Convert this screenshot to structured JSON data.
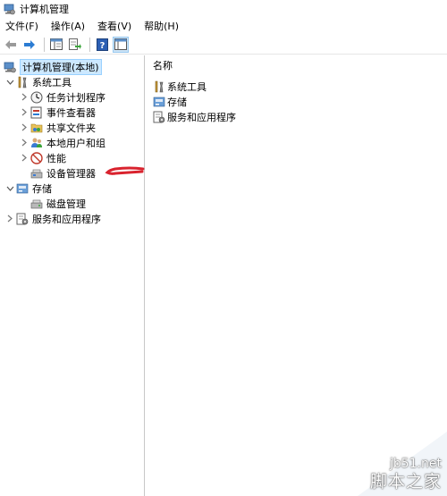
{
  "window": {
    "title": "计算机管理"
  },
  "menubar": {
    "items": [
      "文件(F)",
      "操作(A)",
      "查看(V)",
      "帮助(H)"
    ]
  },
  "toolbar": {
    "buttons": [
      "back-arrow-icon",
      "forward-arrow-icon",
      "show-tree-icon",
      "export-list-icon",
      "help-icon",
      "console-view-icon"
    ]
  },
  "tree": {
    "root": "计算机管理(本地)",
    "system_tools": "系统工具",
    "task_scheduler": "任务计划程序",
    "event_viewer": "事件查看器",
    "shared_folders": "共享文件夹",
    "local_users": "本地用户和组",
    "performance": "性能",
    "device_manager": "设备管理器",
    "storage": "存储",
    "disk_management": "磁盘管理",
    "services_apps": "服务和应用程序"
  },
  "list": {
    "column_name": "名称",
    "items": [
      "系统工具",
      "存储",
      "服务和应用程序"
    ]
  },
  "watermark": {
    "url": "jb51.net",
    "name": "脚本之家"
  },
  "colors": {
    "selection": "#cce8ff",
    "arrow": "#d9232e",
    "accent": "#2b7cd3"
  }
}
